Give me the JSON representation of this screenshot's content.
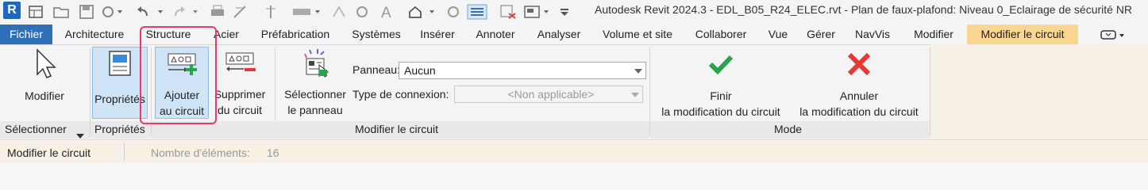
{
  "title": "Autodesk Revit 2024.3 - EDL_B05_R24_ELEC.rvt - Plan de faux-plafond: Niveau 0_Eclairage de sécurité NR",
  "app_logo": "R",
  "tabs": [
    {
      "label": "Fichier"
    },
    {
      "label": "Architecture"
    },
    {
      "label": "Structure"
    },
    {
      "label": "Acier"
    },
    {
      "label": "Préfabrication"
    },
    {
      "label": "Systèmes"
    },
    {
      "label": "Insérer"
    },
    {
      "label": "Annoter"
    },
    {
      "label": "Analyser"
    },
    {
      "label": "Volume et site"
    },
    {
      "label": "Collaborer"
    },
    {
      "label": "Vue"
    },
    {
      "label": "Gérer"
    },
    {
      "label": "NavVis"
    },
    {
      "label": "Modifier"
    },
    {
      "label": "Modifier le circuit"
    }
  ],
  "ribbon": {
    "modify": "Modifier",
    "properties": "Propriétés",
    "add_line1": "Ajouter",
    "add_line2": "au circuit",
    "remove_line1": "Supprimer",
    "remove_line2": "du circuit",
    "select_panel_line1": "Sélectionner",
    "select_panel_line2": "le panneau",
    "panel_label": "Panneau:",
    "panel_value": "Aucun",
    "connection_label": "Type de connexion:",
    "connection_value": "<Non applicable>",
    "finish_line1": "Finir",
    "finish_line2": "la modification du circuit",
    "cancel_line1": "Annuler",
    "cancel_line2": "la modification du circuit"
  },
  "panel_labels": {
    "selector": "Sélectionner",
    "properties": "Propriétés",
    "modify_circuit": "Modifier le circuit",
    "mode": "Mode"
  },
  "status": {
    "mode": "Modifier le circuit",
    "count_label": "Nombre d'éléments:",
    "count_value": "16"
  },
  "colors": {
    "file_tab": "#2f6fb5",
    "active_tab": "#fbd691",
    "highlight": "#e83a6b",
    "check": "#2aa44a",
    "cross": "#e53935"
  }
}
